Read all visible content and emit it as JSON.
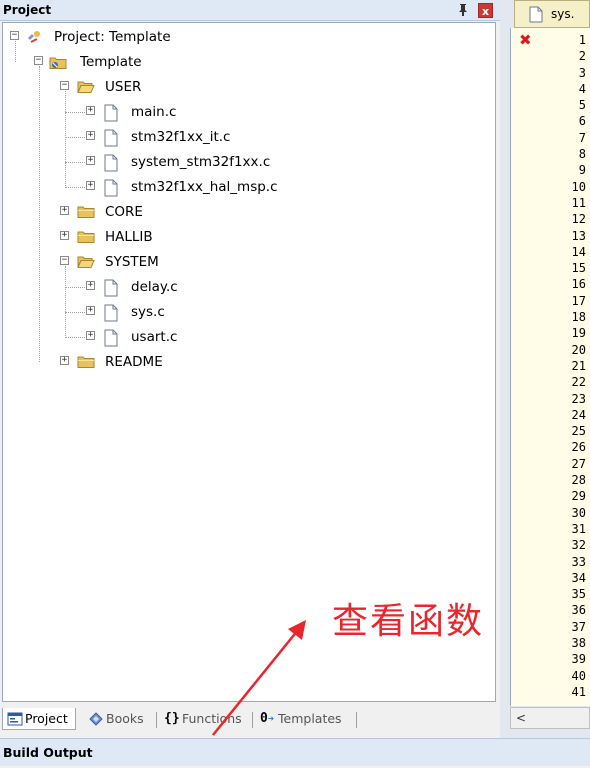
{
  "project_panel": {
    "title": "Project",
    "pin_glyph": "ᵽ",
    "close_glyph": "x"
  },
  "tree": {
    "root": "Project: Template",
    "target": "Template",
    "groups": [
      {
        "label": "USER",
        "expanded": true,
        "files": [
          "main.c",
          "stm32f1xx_it.c",
          "system_stm32f1xx.c",
          "stm32f1xx_hal_msp.c"
        ]
      },
      {
        "label": "CORE",
        "expanded": false,
        "files": []
      },
      {
        "label": "HALLIB",
        "expanded": false,
        "files": []
      },
      {
        "label": "SYSTEM",
        "expanded": true,
        "files": [
          "delay.c",
          "sys.c",
          "usart.c"
        ]
      },
      {
        "label": "README",
        "expanded": false,
        "files": []
      }
    ]
  },
  "tabs": [
    {
      "label": "Project",
      "icon": "project-icon",
      "active": true
    },
    {
      "label": "Books",
      "icon": "books-icon",
      "active": false
    },
    {
      "label": "Functions",
      "icon": "functions-icon",
      "active": false
    },
    {
      "label": "Templates",
      "icon": "templates-icon",
      "active": false
    }
  ],
  "editor": {
    "file_tab": "sys.",
    "line_numbers": [
      "1",
      "2",
      "3",
      "4",
      "5",
      "6",
      "7",
      "8",
      "9",
      "10",
      "11",
      "12",
      "13",
      "14",
      "15",
      "16",
      "17",
      "18",
      "19",
      "20",
      "21",
      "22",
      "23",
      "24",
      "25",
      "26",
      "27",
      "28",
      "29",
      "30",
      "31",
      "32",
      "33",
      "34",
      "35",
      "36",
      "37",
      "38",
      "39",
      "40",
      "41"
    ],
    "error_marker": "✖",
    "scroll_left": "<"
  },
  "build_output": {
    "title": "Build Output"
  },
  "annotation": {
    "text": "查看函数",
    "color": "#e8262c"
  },
  "colors": {
    "folder": "#e8c25a",
    "header": "#dfe8f5",
    "error": "#d21f1f"
  }
}
